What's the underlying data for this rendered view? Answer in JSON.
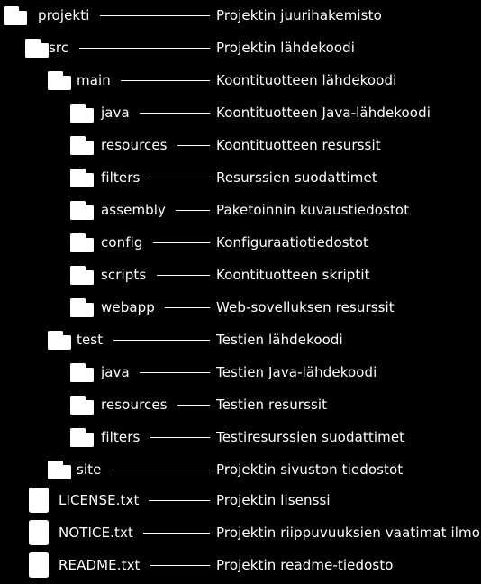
{
  "diagram": {
    "kind": "directory-tree",
    "background_color": "#000000",
    "text_color": "#ffffff",
    "connector_color": "#ffffff",
    "language": "fi",
    "rows": [
      {
        "name": "projekti",
        "description": "Projektin juurihakemisto",
        "icon": "folder-icon",
        "type": "folder",
        "depth": 0
      },
      {
        "name": "src",
        "description": "Projektin lähdekoodi",
        "icon": "folder-icon",
        "type": "folder",
        "depth": 1
      },
      {
        "name": "main",
        "description": "Koontituotteen lähdekoodi",
        "icon": "folder-icon",
        "type": "folder",
        "depth": 2
      },
      {
        "name": "java",
        "description": "Koontituotteen Java-lähdekoodi",
        "icon": "folder-icon",
        "type": "folder",
        "depth": 3
      },
      {
        "name": "resources",
        "description": "Koontituotteen resurssit",
        "icon": "folder-icon",
        "type": "folder",
        "depth": 3
      },
      {
        "name": "filters",
        "description": "Resurssien suodattimet",
        "icon": "folder-icon",
        "type": "folder",
        "depth": 3
      },
      {
        "name": "assembly",
        "description": "Paketoinnin kuvaustiedostot",
        "icon": "folder-icon",
        "type": "folder",
        "depth": 3
      },
      {
        "name": "config",
        "description": "Konfiguraatiotiedostot",
        "icon": "folder-icon",
        "type": "folder",
        "depth": 3
      },
      {
        "name": "scripts",
        "description": "Koontituotteen skriptit",
        "icon": "folder-icon",
        "type": "folder",
        "depth": 3
      },
      {
        "name": "webapp",
        "description": "Web-sovelluksen resurssit",
        "icon": "folder-icon",
        "type": "folder",
        "depth": 3
      },
      {
        "name": "test",
        "description": "Testien lähdekoodi",
        "icon": "folder-icon",
        "type": "folder",
        "depth": 2
      },
      {
        "name": "java",
        "description": "Testien Java-lähdekoodi",
        "icon": "folder-icon",
        "type": "folder",
        "depth": 3
      },
      {
        "name": "resources",
        "description": "Testien resurssit",
        "icon": "folder-icon",
        "type": "folder",
        "depth": 3
      },
      {
        "name": "filters",
        "description": "Testiresurssien suodattimet",
        "icon": "folder-icon",
        "type": "folder",
        "depth": 3
      },
      {
        "name": "site",
        "description": "Projektin sivuston tiedostot",
        "icon": "folder-icon",
        "type": "folder",
        "depth": 2
      },
      {
        "name": "LICENSE.txt",
        "description": "Projektin lisenssi",
        "icon": "file-icon",
        "type": "file",
        "depth": 1
      },
      {
        "name": "NOTICE.txt",
        "description": "Projektin riippuvuuksien vaatimat ilmoitukset",
        "icon": "file-icon",
        "type": "file",
        "depth": 1
      },
      {
        "name": "README.txt",
        "description": "Projektin readme-tiedosto",
        "icon": "file-icon",
        "type": "file",
        "depth": 1
      }
    ]
  }
}
